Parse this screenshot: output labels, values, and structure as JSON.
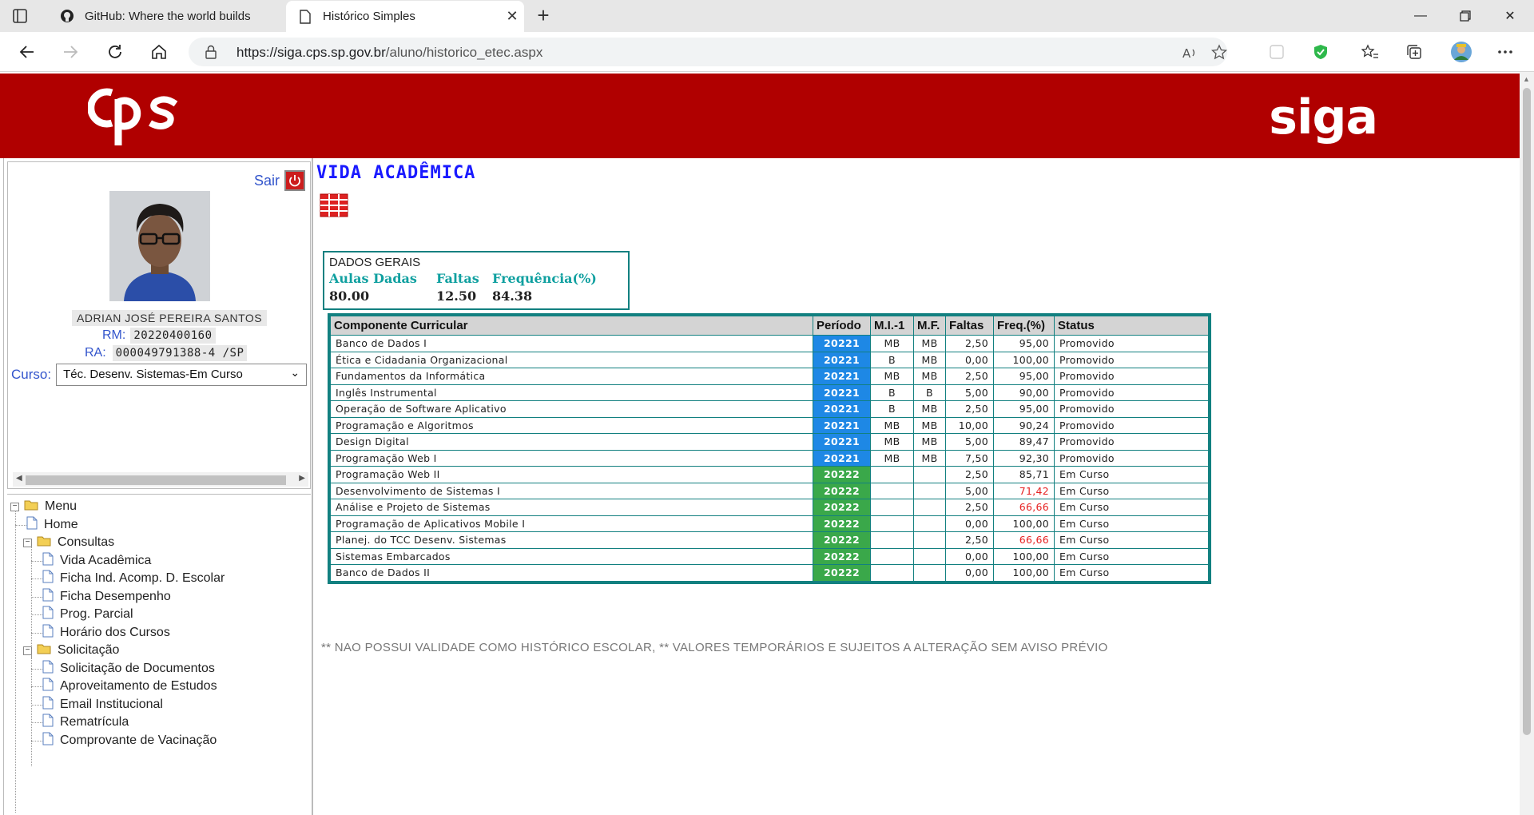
{
  "browser": {
    "tabs": [
      {
        "title": "GitHub: Where the world builds",
        "active": false
      },
      {
        "title": "Histórico Simples",
        "active": true
      }
    ],
    "url_host": "https://siga.cps.sp.gov.br",
    "url_path": "/aluno/historico_etec.aspx"
  },
  "brand": {
    "left_logo": "cps",
    "right_logo": "siga",
    "banner_color": "#b00000"
  },
  "user": {
    "logout_label": "Sair",
    "name": "ADRIAN JOSÉ PEREIRA SANTOS",
    "rm_label": "RM:",
    "rm": "20220400160",
    "ra_label": "RA:",
    "ra": "000049791388-4 /SP",
    "curso_label": "Curso:",
    "curso": "Téc. Desenv. Sistemas-Em Curso"
  },
  "menu": {
    "root": "Menu",
    "items": [
      {
        "label": "Home",
        "level": 1,
        "type": "page"
      },
      {
        "label": "Consultas",
        "level": 1,
        "type": "folder"
      },
      {
        "label": "Vida Acadêmica",
        "level": 2,
        "type": "page"
      },
      {
        "label": "Ficha Ind. Acomp. D. Escolar",
        "level": 2,
        "type": "page"
      },
      {
        "label": "Ficha Desempenho",
        "level": 2,
        "type": "page"
      },
      {
        "label": "Prog. Parcial",
        "level": 2,
        "type": "page"
      },
      {
        "label": "Horário dos Cursos",
        "level": 2,
        "type": "page"
      },
      {
        "label": "Solicitação",
        "level": 1,
        "type": "folder"
      },
      {
        "label": "Solicitação de Documentos",
        "level": 2,
        "type": "page"
      },
      {
        "label": "Aproveitamento de Estudos",
        "level": 2,
        "type": "page"
      },
      {
        "label": "Email Institucional",
        "level": 2,
        "type": "page"
      },
      {
        "label": "Rematrícula",
        "level": 2,
        "type": "page"
      },
      {
        "label": "Comprovante de Vacinação",
        "level": 2,
        "type": "page"
      }
    ]
  },
  "main": {
    "title": "VIDA ACADÊMICA",
    "general": {
      "title": "DADOS GERAIS",
      "headers": [
        "Aulas Dadas",
        "Faltas",
        "Frequência(%)"
      ],
      "values": [
        "80.00",
        "12.50",
        "84.38"
      ]
    },
    "table": {
      "headers": [
        "Componente Curricular",
        "Período",
        "M.I.-1",
        "M.F.",
        "Faltas",
        "Freq.(%)",
        "Status"
      ],
      "rows": [
        [
          "Banco de Dados I",
          "20221",
          "MB",
          "MB",
          "2,50",
          "95,00",
          "Promovido"
        ],
        [
          "Ética e Cidadania Organizacional",
          "20221",
          "B",
          "MB",
          "0,00",
          "100,00",
          "Promovido"
        ],
        [
          "Fundamentos da Informática",
          "20221",
          "MB",
          "MB",
          "2,50",
          "95,00",
          "Promovido"
        ],
        [
          "Inglês Instrumental",
          "20221",
          "B",
          "B",
          "5,00",
          "90,00",
          "Promovido"
        ],
        [
          "Operação de Software Aplicativo",
          "20221",
          "B",
          "MB",
          "2,50",
          "95,00",
          "Promovido"
        ],
        [
          "Programação e Algoritmos",
          "20221",
          "MB",
          "MB",
          "10,00",
          "90,24",
          "Promovido"
        ],
        [
          "Design Digital",
          "20221",
          "MB",
          "MB",
          "5,00",
          "89,47",
          "Promovido"
        ],
        [
          "Programação Web I",
          "20221",
          "MB",
          "MB",
          "7,50",
          "92,30",
          "Promovido"
        ],
        [
          "Programação Web II",
          "20222",
          "",
          "",
          "2,50",
          "85,71",
          "Em Curso"
        ],
        [
          "Desenvolvimento de Sistemas I",
          "20222",
          "",
          "",
          "5,00",
          "71,42",
          "Em Curso"
        ],
        [
          "Análise e Projeto de Sistemas",
          "20222",
          "",
          "",
          "2,50",
          "66,66",
          "Em Curso"
        ],
        [
          "Programação de Aplicativos Mobile I",
          "20222",
          "",
          "",
          "0,00",
          "100,00",
          "Em Curso"
        ],
        [
          "Planej. do TCC Desenv. Sistemas",
          "20222",
          "",
          "",
          "2,50",
          "66,66",
          "Em Curso"
        ],
        [
          "Sistemas Embarcados",
          "20222",
          "",
          "",
          "0,00",
          "100,00",
          "Em Curso"
        ],
        [
          "Banco de Dados II",
          "20222",
          "",
          "",
          "0,00",
          "100,00",
          "Em Curso"
        ]
      ],
      "red_freq_rows": [
        9,
        10,
        12
      ],
      "period_colors": {
        "20221": "#1e88e5",
        "20222": "#3aa84a"
      }
    },
    "footnote": "** NAO POSSUI VALIDADE COMO HISTÓRICO ESCOLAR, ** VALORES TEMPORÁRIOS E SUJEITOS A ALTERAÇÃO SEM AVISO PRÉVIO"
  }
}
